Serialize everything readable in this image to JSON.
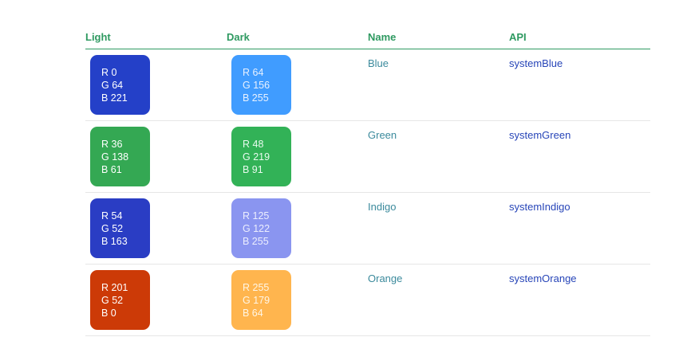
{
  "header": {
    "light": "Light",
    "dark": "Dark",
    "name": "Name",
    "api": "API"
  },
  "rows": [
    {
      "light": {
        "r": "R 0",
        "g": "G 64",
        "b": "B 221",
        "color": "#2440c8",
        "text_color": "#ffffff"
      },
      "dark": {
        "r": "R 64",
        "g": "G 156",
        "b": "B 255",
        "color": "#409cff",
        "text_color": "#e8f1ff"
      },
      "name": "Blue",
      "api": "systemBlue"
    },
    {
      "light": {
        "r": "R 36",
        "g": "G 138",
        "b": "B 61",
        "color": "#34a853",
        "text_color": "#ffffff"
      },
      "dark": {
        "r": "R 48",
        "g": "G 219",
        "b": "B 91",
        "color": "#32b257",
        "text_color": "#e9fbef"
      },
      "name": "Green",
      "api": "systemGreen"
    },
    {
      "light": {
        "r": "R 54",
        "g": "G 52",
        "b": "B 163",
        "color": "#2a3dc4",
        "text_color": "#ffffff"
      },
      "dark": {
        "r": "R 125",
        "g": "G 122",
        "b": "B 255",
        "color": "#8a95f0",
        "text_color": "#eceefe"
      },
      "name": "Indigo",
      "api": "systemIndigo"
    },
    {
      "light": {
        "r": "R 201",
        "g": "G 52",
        "b": "B 0",
        "color": "#cc3a07",
        "text_color": "#ffffff"
      },
      "dark": {
        "r": "R 255",
        "g": "G 179",
        "b": "B 64",
        "color": "#ffb54e",
        "text_color": "#fff6e6"
      },
      "name": "Orange",
      "api": "systemOrange"
    }
  ]
}
